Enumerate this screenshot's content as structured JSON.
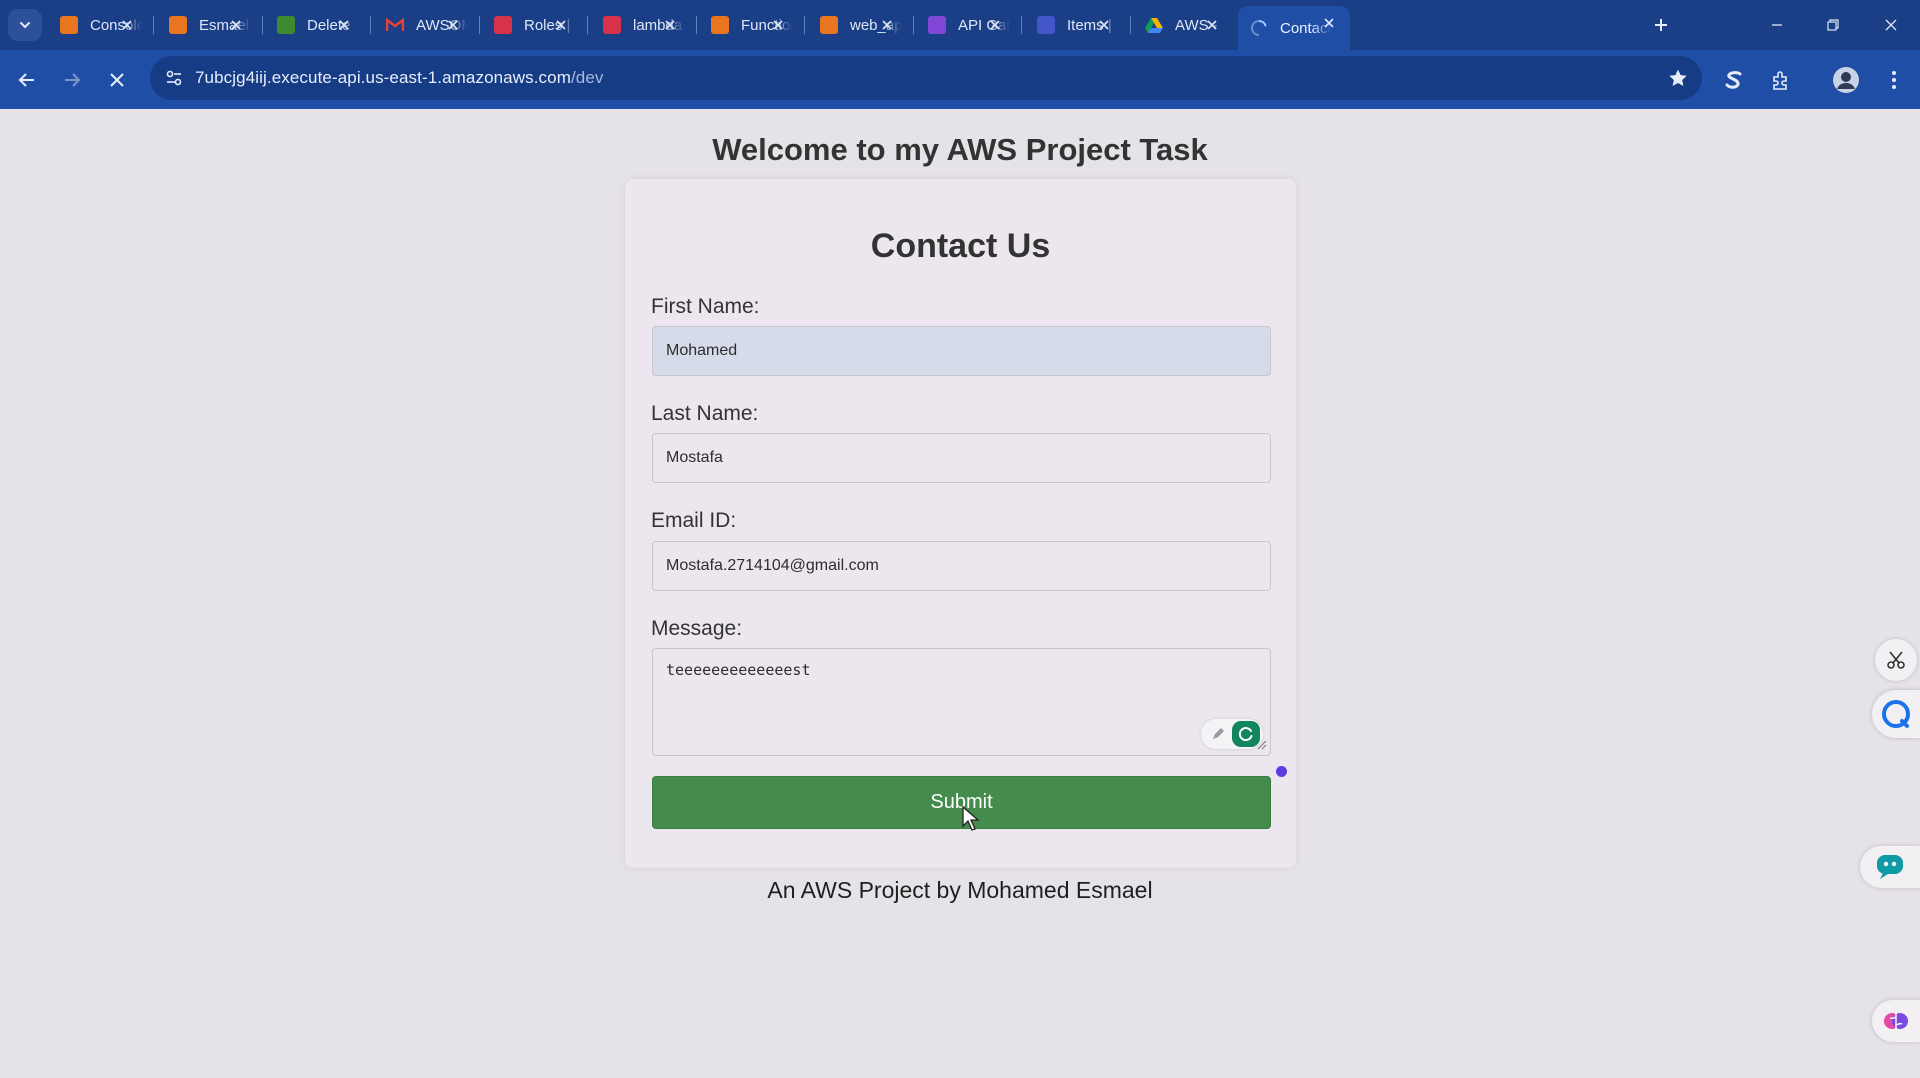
{
  "browser": {
    "tabs": [
      {
        "title": "Console Home",
        "favicon": "aws-console-icon",
        "color": "#e7761f"
      },
      {
        "title": "Esmael",
        "favicon": "lambda-icon",
        "color": "#e7761f"
      },
      {
        "title": "Delete",
        "favicon": "s3-icon",
        "color": "#3d8a2f"
      },
      {
        "title": "AWSOM",
        "favicon": "gmail-icon",
        "color": "#ffffff"
      },
      {
        "title": "Roles |",
        "favicon": "iam-icon",
        "color": "#d6334a"
      },
      {
        "title": "lambda",
        "favicon": "iam-icon",
        "color": "#d6334a"
      },
      {
        "title": "Functions",
        "favicon": "lambda-icon",
        "color": "#e7761f"
      },
      {
        "title": "web_app",
        "favicon": "lambda-icon",
        "color": "#e7761f"
      },
      {
        "title": "API Gateway",
        "favicon": "api-gateway-icon",
        "color": "#8046d6"
      },
      {
        "title": "Items |",
        "favicon": "dynamodb-icon",
        "color": "#4356c8"
      },
      {
        "title": "AWS -",
        "favicon": "drive-icon",
        "color": "#f4b400"
      },
      {
        "title": "Contact",
        "favicon": "loading-spinner-icon",
        "color": "#9fd0ff",
        "active": true
      }
    ],
    "url_host": "7ubcjg4iij.execute-api.us-east-1.amazonaws.com",
    "url_path": "/dev"
  },
  "page": {
    "heading": "Welcome to my AWS Project Task",
    "form_title": "Contact Us",
    "fields": {
      "first_name_label": "First Name:",
      "first_name_value": "Mohamed",
      "last_name_label": "Last Name:",
      "last_name_value": "Mostafa",
      "email_label": "Email ID:",
      "email_value": "Mostafa.2714104@gmail.com",
      "message_label": "Message:",
      "message_value": "teeeeeeeeeeeeest"
    },
    "submit_label": "Submit",
    "footer": "An AWS Project by Mohamed Esmael"
  },
  "colors": {
    "tabstrip": "#1b3f86",
    "toolbar": "#1f4ea7",
    "page_bg": "#e6e3e8",
    "submit_bg": "#458b4b"
  }
}
